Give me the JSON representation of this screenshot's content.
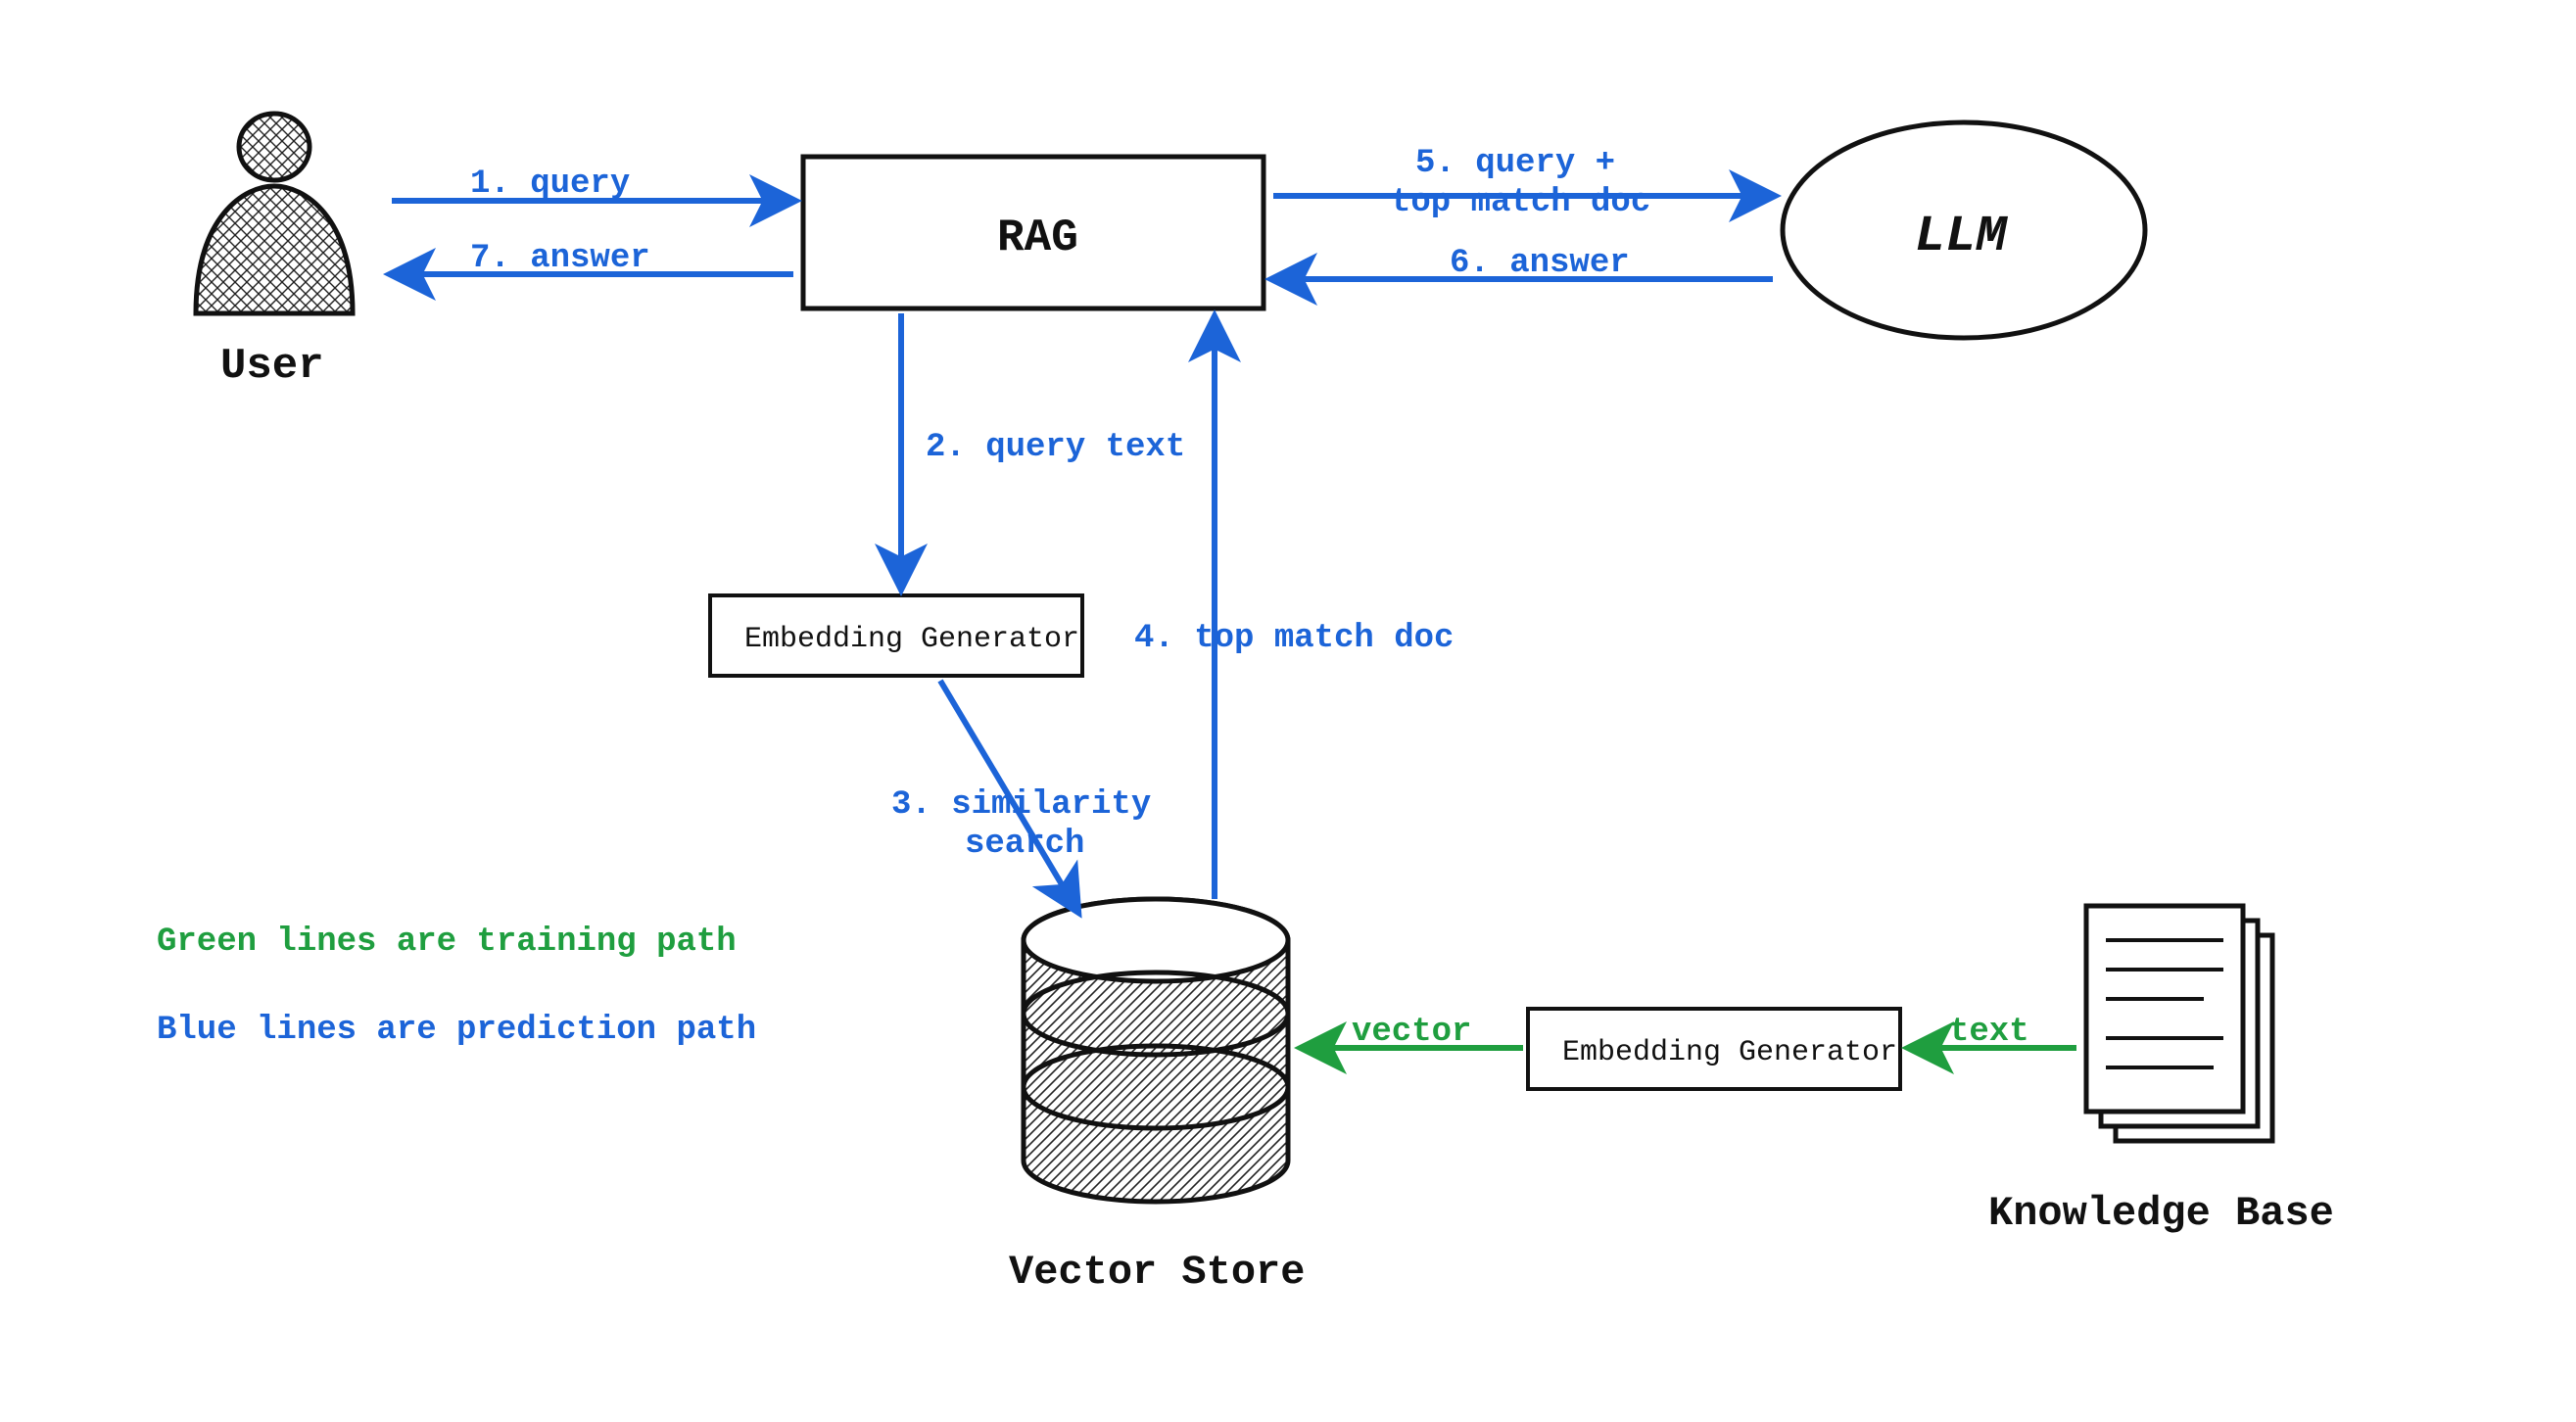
{
  "nodes": {
    "user_label": "User",
    "rag_label": "RAG",
    "llm_label": "LLM",
    "embedding_generator_top": "Embedding Generator",
    "embedding_generator_bottom": "Embedding Generator",
    "vector_store_label": "Vector Store",
    "knowledge_base_label": "Knowledge Base"
  },
  "edges": {
    "e1_query": "1. query",
    "e2_query_text": "2. query text",
    "e3_similarity_search_line1": "3. similarity",
    "e3_similarity_search_line2": "search",
    "e4_top_match_doc": "4. top match doc",
    "e5_query_top_match_line1": "5. query +",
    "e5_query_top_match_line2": "top match doc",
    "e6_answer": "6. answer",
    "e7_answer": "7. answer",
    "vector": "vector",
    "text": "text"
  },
  "legend": {
    "green": "Green lines are training path",
    "blue": "Blue lines are prediction path"
  },
  "colors": {
    "blue": "#1c64d8",
    "green": "#1f9e3f",
    "black": "#111111"
  }
}
